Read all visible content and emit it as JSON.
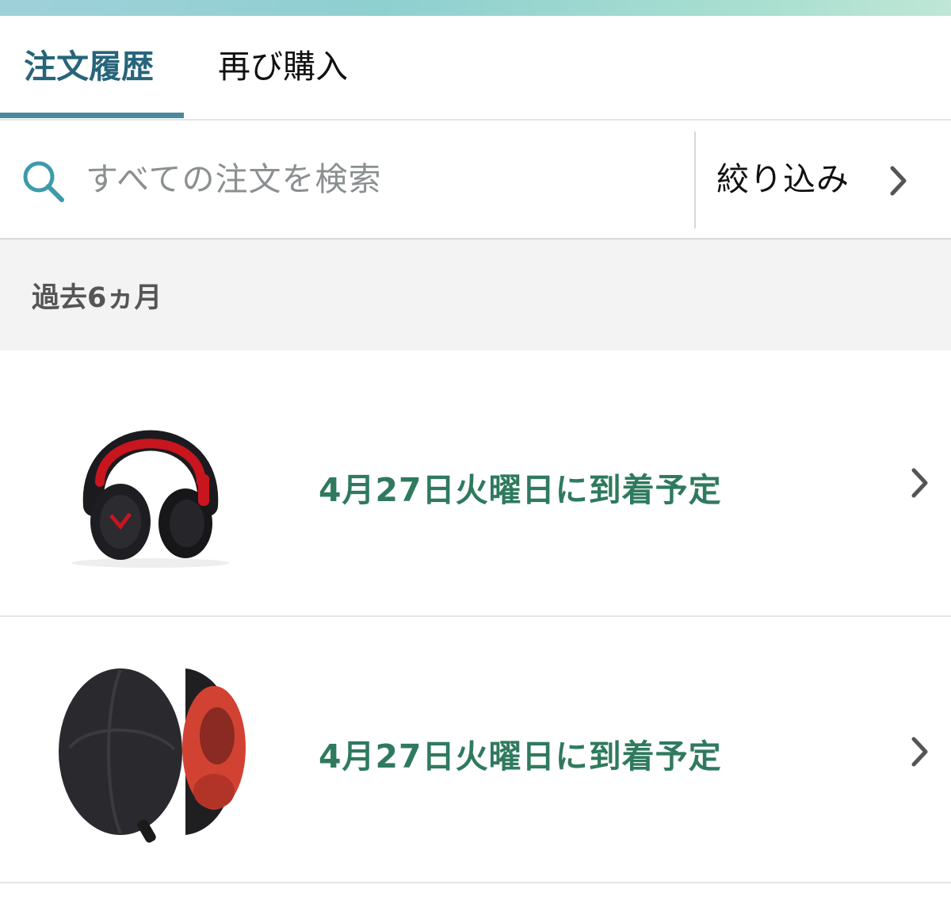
{
  "tabs": [
    {
      "label": "注文履歴",
      "active": true
    },
    {
      "label": "再び購入",
      "active": false
    }
  ],
  "search": {
    "placeholder": "すべての注文を検索",
    "icon": "search-icon"
  },
  "filter": {
    "label": "絞り込み",
    "icon": "chevron-right-icon"
  },
  "section": {
    "title": "過去6ヵ月"
  },
  "orders": [
    {
      "status": "4月27日火曜日に到着予定",
      "image": "red-black-headphones-image"
    },
    {
      "status": "4月27日火曜日に到着予定",
      "image": "headphone-case-image"
    }
  ],
  "colors": {
    "accent": "#26657a",
    "status_text": "#2f7a5e",
    "section_bg": "#f3f3f3"
  }
}
